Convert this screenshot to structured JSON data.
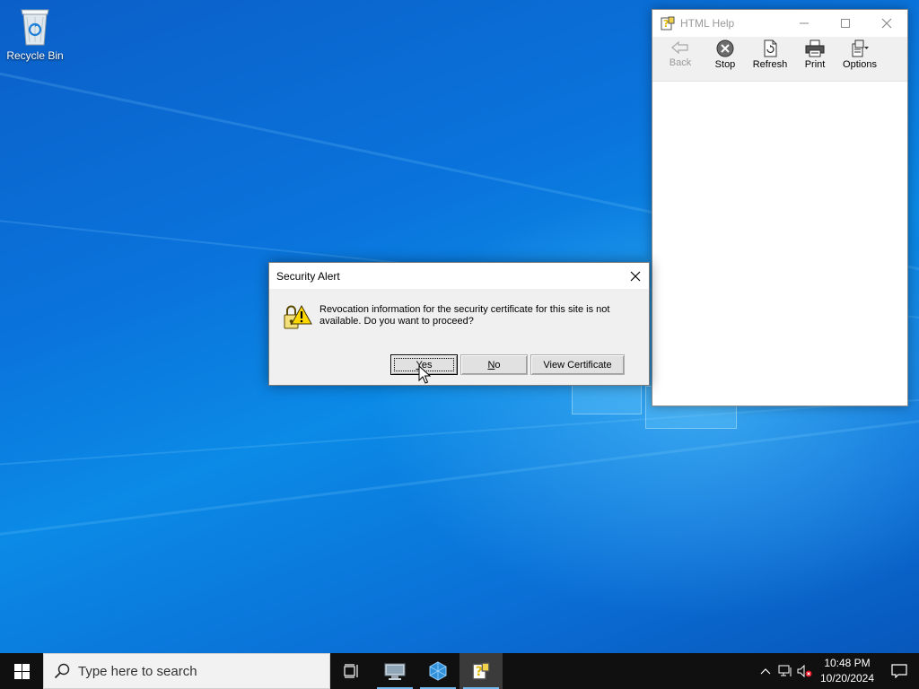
{
  "desktop": {
    "icons": [
      {
        "label": "Recycle Bin",
        "icon": "recycle-bin-icon"
      }
    ]
  },
  "help_window": {
    "title": "HTML Help",
    "toolbar": {
      "back": "Back",
      "stop": "Stop",
      "refresh": "Refresh",
      "print": "Print",
      "options": "Options"
    }
  },
  "security_alert": {
    "title": "Security Alert",
    "message": "Revocation information for the security certificate for this site is not available. Do you want to proceed?",
    "buttons": {
      "yes": "Yes",
      "no": "No",
      "view_certificate": "View Certificate"
    }
  },
  "taskbar": {
    "search_placeholder": "Type here to search",
    "clock_time": "10:48 PM",
    "clock_date": "10/20/2024",
    "pinned_apps": [
      "task-view-icon",
      "server-manager-icon",
      "azure-icon",
      "html-help-icon"
    ]
  },
  "colors": {
    "taskbar_bg": "#101010",
    "running_indicator": "#76b9ed",
    "desktop_blue": "#0a74dc"
  }
}
